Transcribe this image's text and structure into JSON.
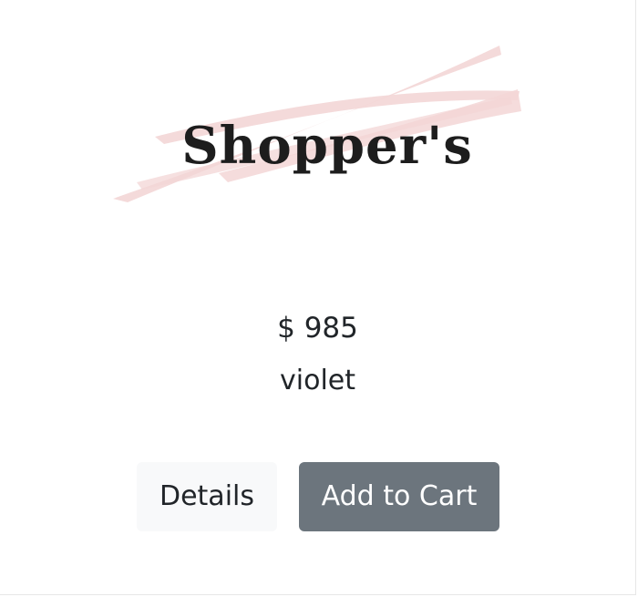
{
  "product": {
    "logo_text": "Shopper's",
    "price": "$ 985",
    "color_name": "violet"
  },
  "actions": {
    "details_label": "Details",
    "add_to_cart_label": "Add to Cart"
  },
  "colors": {
    "brush_stroke": "#f3d6d6",
    "secondary_button": "#6c757d",
    "light_button": "#f8f9fa"
  }
}
